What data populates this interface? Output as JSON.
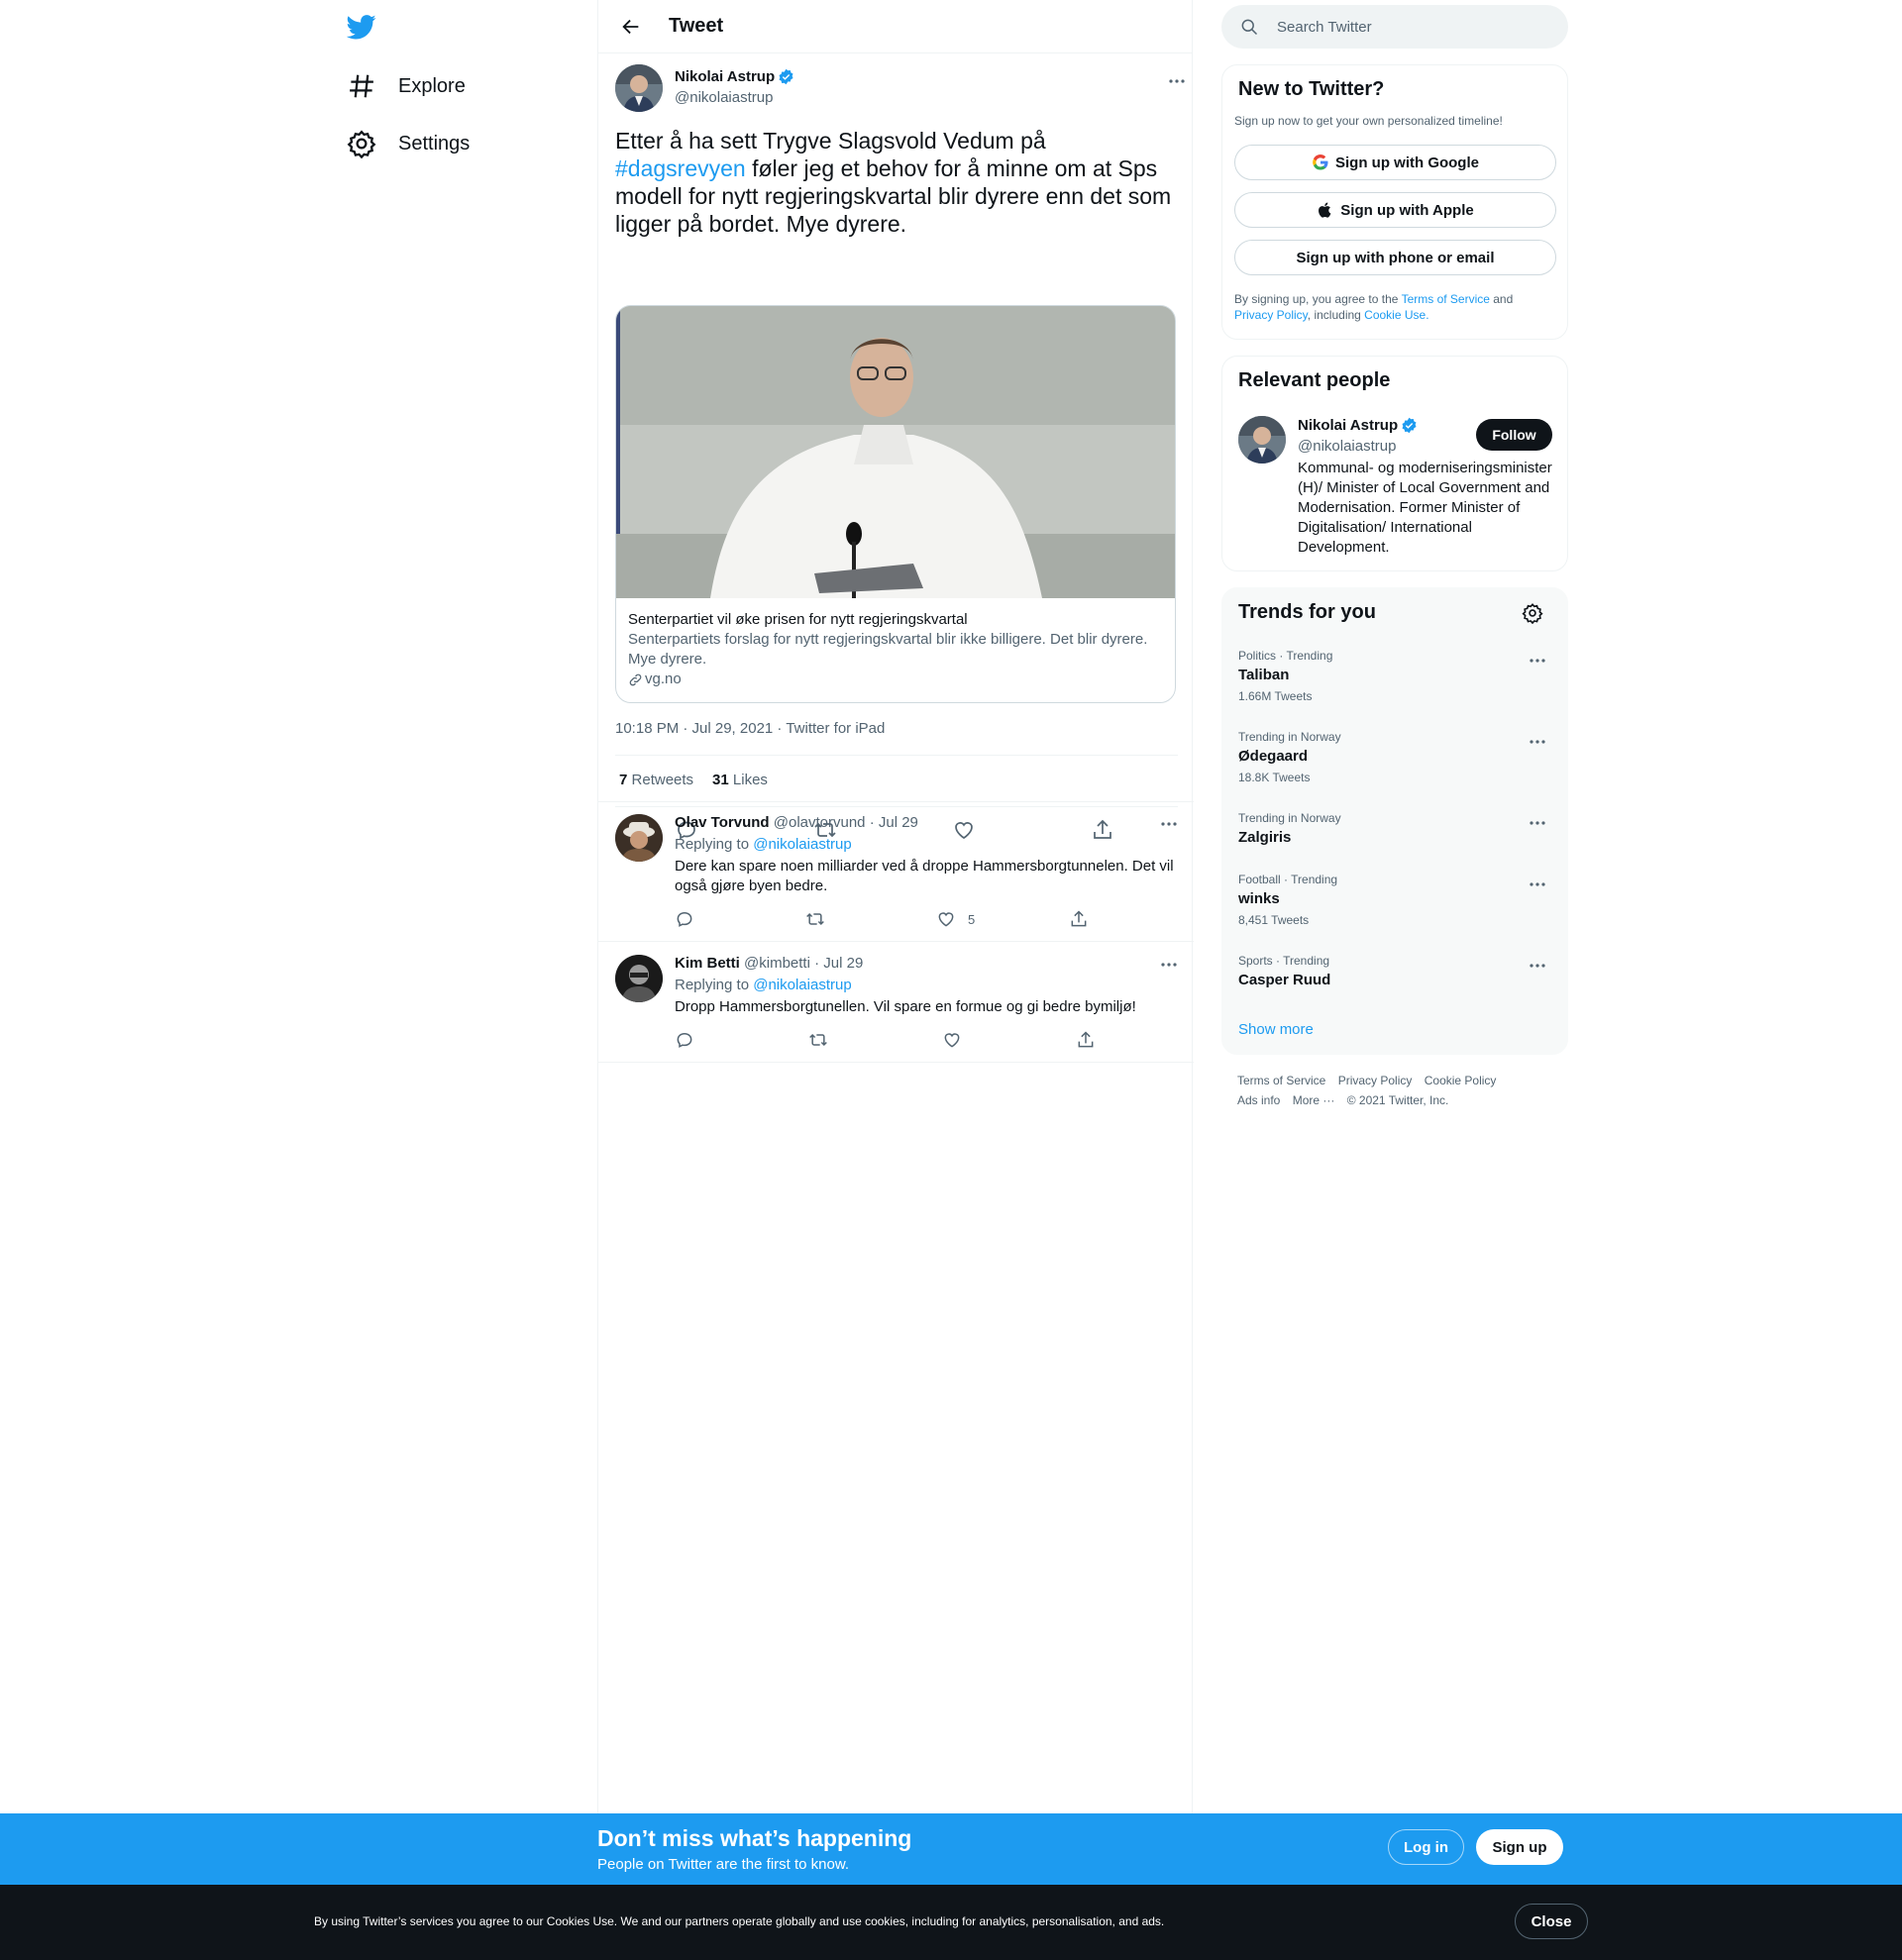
{
  "nav": {
    "logo": "twitter-bird-icon",
    "items": [
      {
        "label": "Explore",
        "icon": "hashtag-icon"
      },
      {
        "label": "Settings",
        "icon": "gear-icon"
      }
    ]
  },
  "main": {
    "title": "Tweet",
    "tweet": {
      "name": "Nikolai Astrup",
      "handle": "@nikolaiastrup",
      "text_before": "Etter å ha sett Trygve Slagsvold Vedum på ",
      "hashtag": "#dagsrevyen",
      "text_after": " føler jeg et behov for å minne om at Sps modell for nytt regjeringskvartal blir dyrere enn det som ligger på bordet. Mye dyrere.",
      "card": {
        "title": "Senterpartiet vil øke prisen for nytt regjeringskvartal",
        "description": "Senterpartiets forslag for nytt regjeringskvartal blir ikke billigere. Det blir dyrere. Mye dyrere.",
        "domain": "vg.no"
      },
      "meta": "10:18 PM · Jul 29, 2021 · Twitter for iPad",
      "retweets_count": "7",
      "retweets_label": "Retweets",
      "likes_count": "31",
      "likes_label": "Likes"
    },
    "replies": [
      {
        "name": "Olav Torvund",
        "handle": "@olavtorvund",
        "date": "· Jul 29",
        "replying_prefix": "Replying to",
        "replying_to": "@nikolaiastrup",
        "text": "Dere kan spare noen milliarder ved å droppe Hammersborgtunnelen. Det vil også gjøre byen bedre.",
        "likes": "5"
      },
      {
        "name": "Kim Betti",
        "handle": "@kimbetti",
        "date": "· Jul 29",
        "replying_prefix": "Replying to",
        "replying_to": "@nikolaiastrup",
        "text": "Dropp Hammersborgtunellen. Vil spare en formue og gi bedre bymiljø!",
        "likes": ""
      }
    ]
  },
  "right": {
    "search_placeholder": "Search Twitter",
    "new_to_twitter": {
      "title": "New to Twitter?",
      "subtitle": "Sign up now to get your own personalized timeline!",
      "google": "Sign up with Google",
      "apple": "Sign up with Apple",
      "phone": "Sign up with phone or email",
      "legal_1": "By signing up, you agree to the ",
      "terms": "Terms of Service",
      "legal_2": " and ",
      "privacy": "Privacy Policy",
      "legal_3": ", including ",
      "cookie": "Cookie Use."
    },
    "relevant_people": {
      "title": "Relevant people",
      "name": "Nikolai Astrup",
      "handle": "@nikolaiastrup",
      "follow": "Follow",
      "bio": "Kommunal- og moderniseringsminister (H)/ Minister of Local Government and Modernisation. Former Minister of Digitalisation/ International Development."
    },
    "trends": {
      "title": "Trends for you",
      "items": [
        {
          "context": "Politics · Trending",
          "name": "Taliban",
          "count": "1.66M Tweets"
        },
        {
          "context": "Trending in Norway",
          "name": "Ødegaard",
          "count": "18.8K Tweets"
        },
        {
          "context": "Trending in Norway",
          "name": "Zalgiris",
          "count": ""
        },
        {
          "context": "Football · Trending",
          "name": "winks",
          "count": "8,451 Tweets"
        },
        {
          "context": "Sports · Trending",
          "name": "Casper Ruud",
          "count": ""
        }
      ],
      "show_more": "Show more"
    },
    "footer": {
      "terms": "Terms of Service",
      "privacy": "Privacy Policy",
      "cookie": "Cookie Policy",
      "ads": "Ads info",
      "more": "More ···",
      "copyright": "© 2021 Twitter, Inc."
    }
  },
  "bottom_bar": {
    "title": "Don’t miss what’s happening",
    "subtitle": "People on Twitter are the first to know.",
    "login": "Log in",
    "signup": "Sign up"
  },
  "cookie_bar": {
    "text": "By using Twitter’s services you agree to our Cookies Use. We and our partners operate globally and use cookies, including for analytics, personalisation, and ads.",
    "close": "Close"
  },
  "colors": {
    "accent": "#1d9bf0",
    "text": "#0f1419",
    "secondary": "#536471",
    "cookie_bg": "#0f1419"
  }
}
